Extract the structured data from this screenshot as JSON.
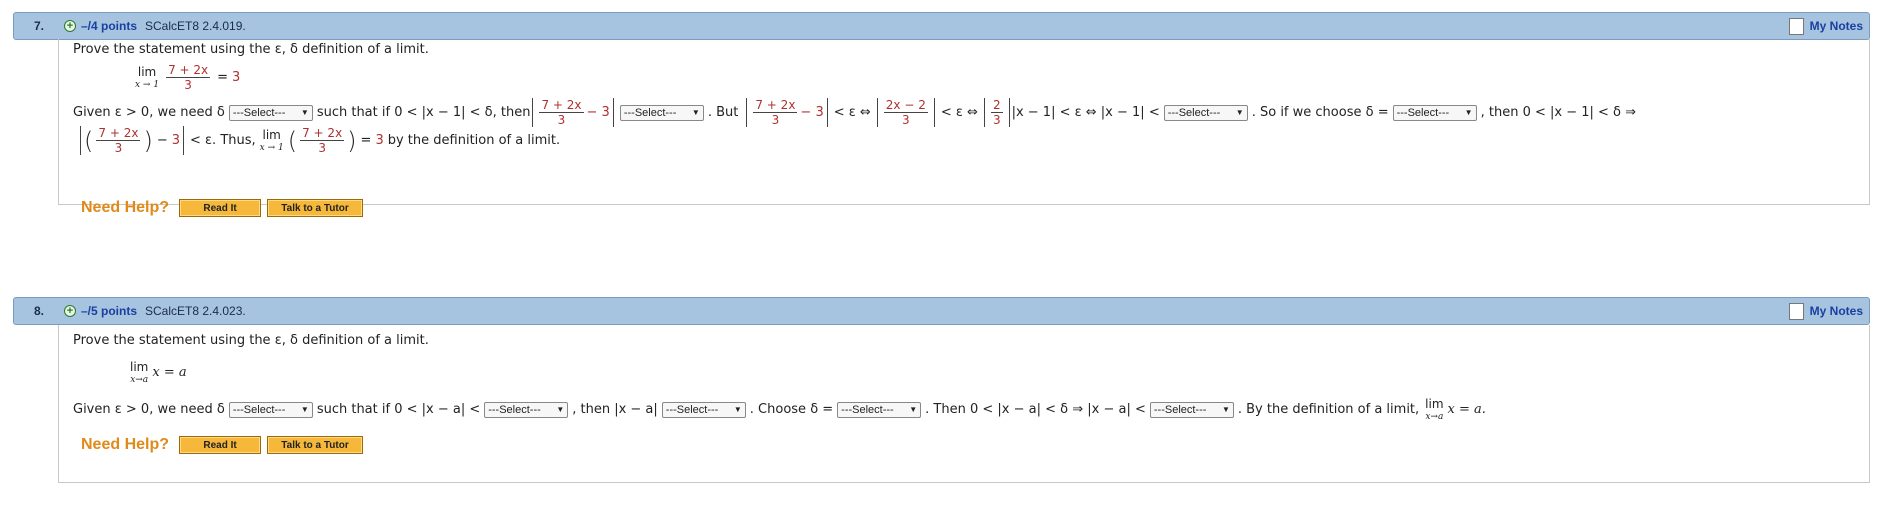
{
  "q7": {
    "number": "7.",
    "points": "–/4 points",
    "source": "SCalcET8 2.4.019.",
    "my_notes": "My Notes",
    "prompt": "Prove the statement using the ε, δ definition of a limit.",
    "lim_word": "lim",
    "lim_sub": "x → 1",
    "frac_num": "7 + 2x",
    "frac_den": "3",
    "equals_val": "3",
    "given_text": "Given ε > 0, we need δ",
    "such_that": "such that if 0 < |x − 1| < δ, then",
    "minus_3": "− 3",
    "but": ". But",
    "lt_eps_iff": "< ε ⇔",
    "frac2_num": "2x − 2",
    "frac2_den": "3",
    "frac3_num": "2",
    "frac3_den": "3",
    "abs_x1": "|x − 1| < ε ⇔ |x − 1| <",
    "so_choose": ". So if we choose  δ =",
    "then_implies": ",  then  0 < |x − 1| < δ  ⇒",
    "thus": "< ε.  Thus,",
    "by_def": "by the definition of a limit.",
    "select_placeholder": "---Select---"
  },
  "q8": {
    "number": "8.",
    "points": "–/5 points",
    "source": "SCalcET8 2.4.023.",
    "my_notes": "My Notes",
    "prompt": "Prove the statement using the ε, δ definition of a limit.",
    "lim_word": "lim",
    "lim_sub": "x→a",
    "lim_expr": "x = a",
    "given_text": "Given  ε > 0,  we need  δ",
    "such_that": "such that if  0 < |x − a| <",
    "then_abs": ",  then  |x − a|",
    "choose": ".  Choose  δ =",
    "then2": ".  Then  0 < |x − a| < δ   ⇒   |x − a| <",
    "by_def": ".  By the definition of a limit,",
    "end_expr": "x = a.",
    "select_placeholder": "---Select---"
  },
  "help": {
    "title": "Need Help?",
    "read_it": "Read It",
    "tutor": "Talk to a Tutor"
  },
  "colors": {
    "header_bg": "#a6c4e0",
    "link": "#1a3fa0",
    "help_orange": "#e08a1a",
    "button": "#f6b83a",
    "red_math": "#b03030"
  }
}
